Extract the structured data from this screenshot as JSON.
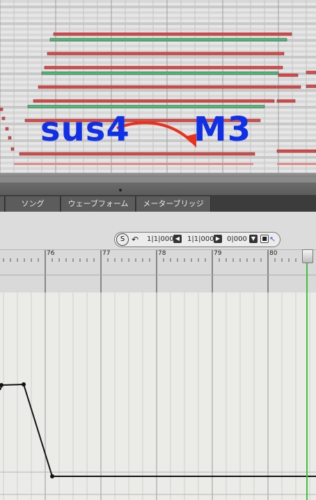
{
  "annotation": {
    "from_label": "sus4",
    "to_label": "M3",
    "text_color": "#1030e8",
    "arrow_color": "#e8321e"
  },
  "tabs": [
    {
      "label": "ソング"
    },
    {
      "label": "ウェーブフォーム"
    },
    {
      "label": "メーターブリッジ"
    }
  ],
  "transport": {
    "sync_label": "S",
    "loop_start": "1|1|000",
    "loop_end": "1|1|000",
    "offset": "0|000"
  },
  "ruler": {
    "bars": [
      "76",
      "77",
      "78",
      "79",
      "80"
    ]
  },
  "colors": {
    "note_red": "#d94a4a",
    "note_green": "#3fbf7a",
    "playhead": "#40c040"
  }
}
